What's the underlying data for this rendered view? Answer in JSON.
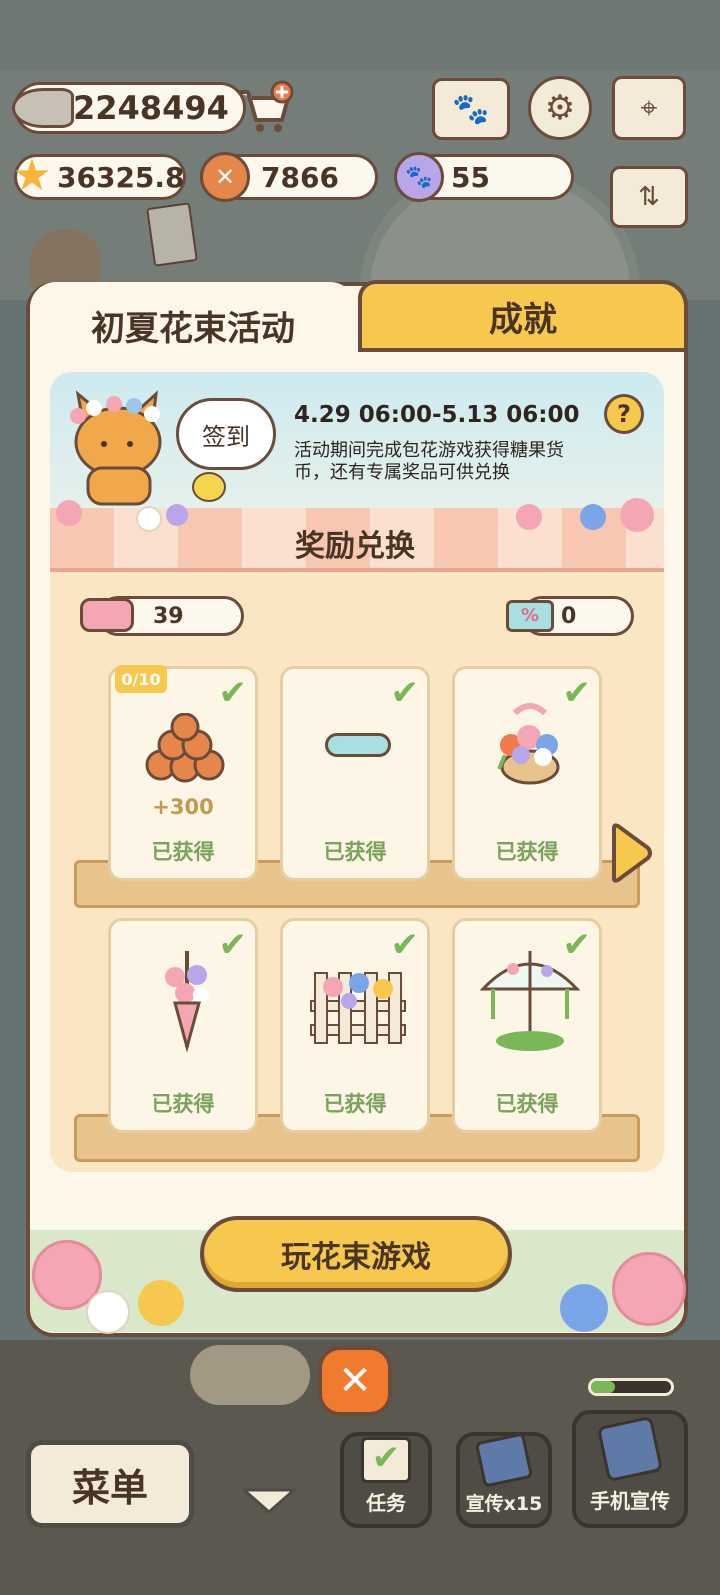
{
  "currency": {
    "fish": "2248494",
    "star": "36325.8",
    "coin": "7866",
    "paw": "55"
  },
  "tabs": {
    "active": "初夏花束活动",
    "inactive": "成就"
  },
  "event": {
    "date": "4.29 06:00-5.13 06:00",
    "description": "活动期间完成包花游戏获得糖果货币，还有专属奖品可供兑换",
    "signin": "签到",
    "help": "?",
    "section_title": "奖励兑换"
  },
  "tokens": {
    "candy": "39",
    "ticket": "0"
  },
  "rewards": [
    {
      "progress": "0/10",
      "bonus": "+300",
      "status": "已获得",
      "icon": "coin-pile-icon"
    },
    {
      "status": "已获得",
      "icon": "ribbon-icon"
    },
    {
      "status": "已获得",
      "icon": "flower-basket-icon"
    },
    {
      "status": "已获得",
      "icon": "bouquet-icon"
    },
    {
      "status": "已获得",
      "icon": "flower-fence-icon"
    },
    {
      "status": "已获得",
      "icon": "flower-umbrella-icon"
    }
  ],
  "play_button": "玩花束游戏",
  "close": "✕",
  "bottom": {
    "menu": "菜单",
    "tasks": "任务",
    "promo": "宣传x15",
    "phone_promo": "手机宣传"
  },
  "colors": {
    "tab_active": "#fdf7ea",
    "tab_inactive": "#f6c94e",
    "accent_yellow": "#f6c94e",
    "obtained_green": "#7aa35c",
    "close_orange": "#f07a2e"
  }
}
